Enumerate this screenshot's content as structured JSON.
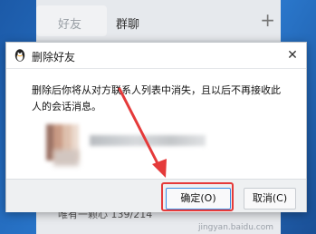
{
  "background": {
    "tabs": [
      {
        "label": "好友"
      },
      {
        "label": "群聊"
      }
    ],
    "add_icon": "plus-icon",
    "bottom_text": "唯有一颗心 139/214",
    "watermark": "jingyan.baidu.com"
  },
  "dialog": {
    "title": "删除好友",
    "title_icon": "qq-penguin-icon",
    "close_label": "✕",
    "message": "删除后你将从对方联系人列表中消失，且以后不再接收此人的会话消息。",
    "ok_label": "确定(O)",
    "cancel_label": "取消(C)"
  },
  "annotation": {
    "color": "#e53a3a"
  }
}
